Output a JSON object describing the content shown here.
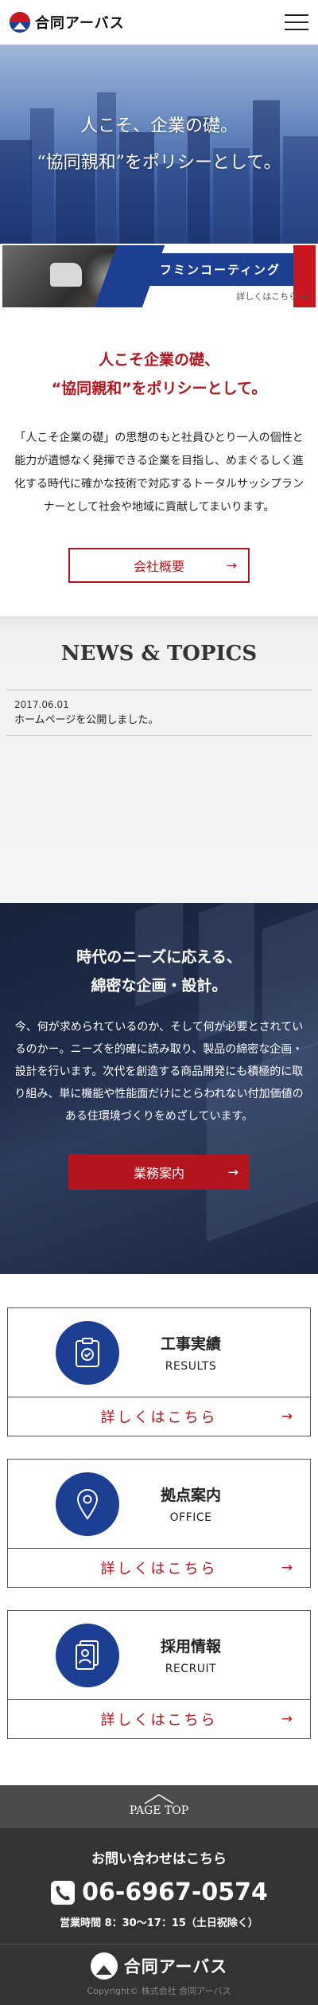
{
  "header": {
    "logo_text": "合同アーバス",
    "menu_icon": "hamburger-menu-icon"
  },
  "hero": {
    "line1": "人こそ、企業の礎。",
    "line2": "“協同親和”をポリシーとして。"
  },
  "banner": {
    "title": "フミンコーティング",
    "more": "詳しくはこちら →"
  },
  "intro": {
    "title_line1": "人こそ企業の礎、",
    "title_line2": "“協同親和”をポリシーとして。",
    "body": "「人こそ企業の礎」の思想のもと社員ひとり一人の個性と能力が遺憾なく発揮できる企業を目指し、めまぐるしく進化する時代に確かな技術で対応するトータルサッシプランナーとして社会や地域に貢献してまいります。",
    "button_label": "会社概要",
    "button_arrow": "→"
  },
  "news": {
    "heading": "NEWS & TOPICS",
    "items": [
      {
        "date": "2017.06.01",
        "text": "ホームページを公開しました。"
      }
    ]
  },
  "planning": {
    "title_line1": "時代のニーズに応える、",
    "title_line2": "綿密な企画・設計。",
    "body": "今、何が求められているのか、そして何が必要とされているのかー。ニーズを的確に読み取り、製品の綿密な企画・設計を行います。次代を創造する商品開発にも積極的に取り組み、単に機能や性能面だけにとらわれない付加価値のある住環境づくりをめざしています。",
    "button_label": "業務案内",
    "button_arrow": "→"
  },
  "cards": [
    {
      "jp": "工事実績",
      "en": "RESULTS",
      "icon": "clipboard-check-icon",
      "more": "詳しくはこちら",
      "arrow": "→"
    },
    {
      "jp": "拠点案内",
      "en": "OFFICE",
      "icon": "map-pin-icon",
      "more": "詳しくはこちら",
      "arrow": "→"
    },
    {
      "jp": "採用情報",
      "en": "RECRUIT",
      "icon": "id-card-icon",
      "more": "詳しくはこちら",
      "arrow": "→"
    }
  ],
  "footer": {
    "pagetop": "PAGE TOP",
    "contact_title": "お問い合わせはこちら",
    "phone": "06-6967-0574",
    "hours": "営業時間 8：30〜17：15（土日祝除く）",
    "logo_text": "合同アーバス",
    "copyright": "Copyright© 株式会社 合同アーバス"
  },
  "colors": {
    "brand_red": "#b2151d",
    "brand_blue": "#1c3f93",
    "footer_dark": "#333333"
  }
}
